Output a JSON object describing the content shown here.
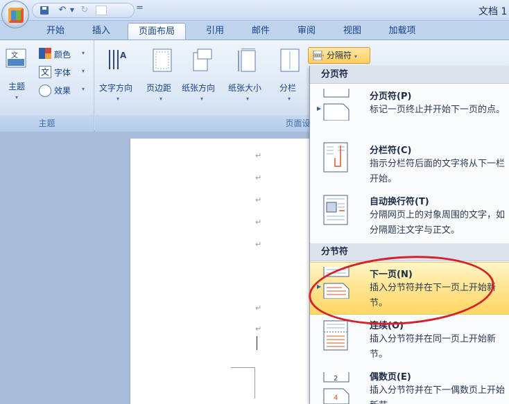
{
  "titlebar": {
    "window_title": "文档 1",
    "qat_end_glyph": "="
  },
  "tabs": [
    {
      "label": "开始"
    },
    {
      "label": "插入"
    },
    {
      "label": "页面布局"
    },
    {
      "label": "引用"
    },
    {
      "label": "邮件"
    },
    {
      "label": "审阅"
    },
    {
      "label": "视图"
    },
    {
      "label": "加载项"
    }
  ],
  "ribbon": {
    "themes": {
      "label": "主题",
      "theme_button": "主题",
      "colors": "颜色",
      "fonts": "字体",
      "effects": "效果"
    },
    "page_setup": {
      "label": "页面设置",
      "text_direction": "文字方向",
      "margins": "页边距",
      "orientation": "纸张方向",
      "size": "纸张大小",
      "columns": "分栏",
      "breaks": "分隔符"
    }
  },
  "menu": {
    "page_breaks_header": "分页符",
    "section_breaks_header": "分节符",
    "items": [
      {
        "title": "分页符(P)",
        "desc": "标记一页终止并开始下一页的点。"
      },
      {
        "title": "分栏符(C)",
        "desc": "指示分栏符后面的文字将从下一栏开始。"
      },
      {
        "title": "自动换行符(T)",
        "desc": "分隔网页上的对象周围的文字，如分隔题注文字与正文。"
      },
      {
        "title": "下一页(N)",
        "desc": "插入分节符并在下一页上开始新节。"
      },
      {
        "title": "连续(O)",
        "desc": "插入分节符并在同一页上开始新节。"
      },
      {
        "title": "偶数页(E)",
        "desc": "插入分节符并在下一偶数页上开始新节。"
      }
    ]
  },
  "document": {
    "paragraph_mark": "↵"
  },
  "icons": [
    "office-button-icon",
    "save-icon",
    "undo-icon",
    "redo-icon",
    "theme-icon",
    "colors-icon",
    "fonts-icon",
    "effects-icon",
    "text-direction-icon",
    "margins-icon",
    "orientation-icon",
    "size-icon",
    "columns-icon",
    "breaks-icon",
    "page-break-icon",
    "column-break-icon",
    "text-wrapping-icon",
    "next-page-icon",
    "continuous-icon",
    "even-page-icon"
  ],
  "colors": {
    "highlight": "#ffd764",
    "annotation": "#d3222a",
    "ribbon": "#dde8f6"
  }
}
